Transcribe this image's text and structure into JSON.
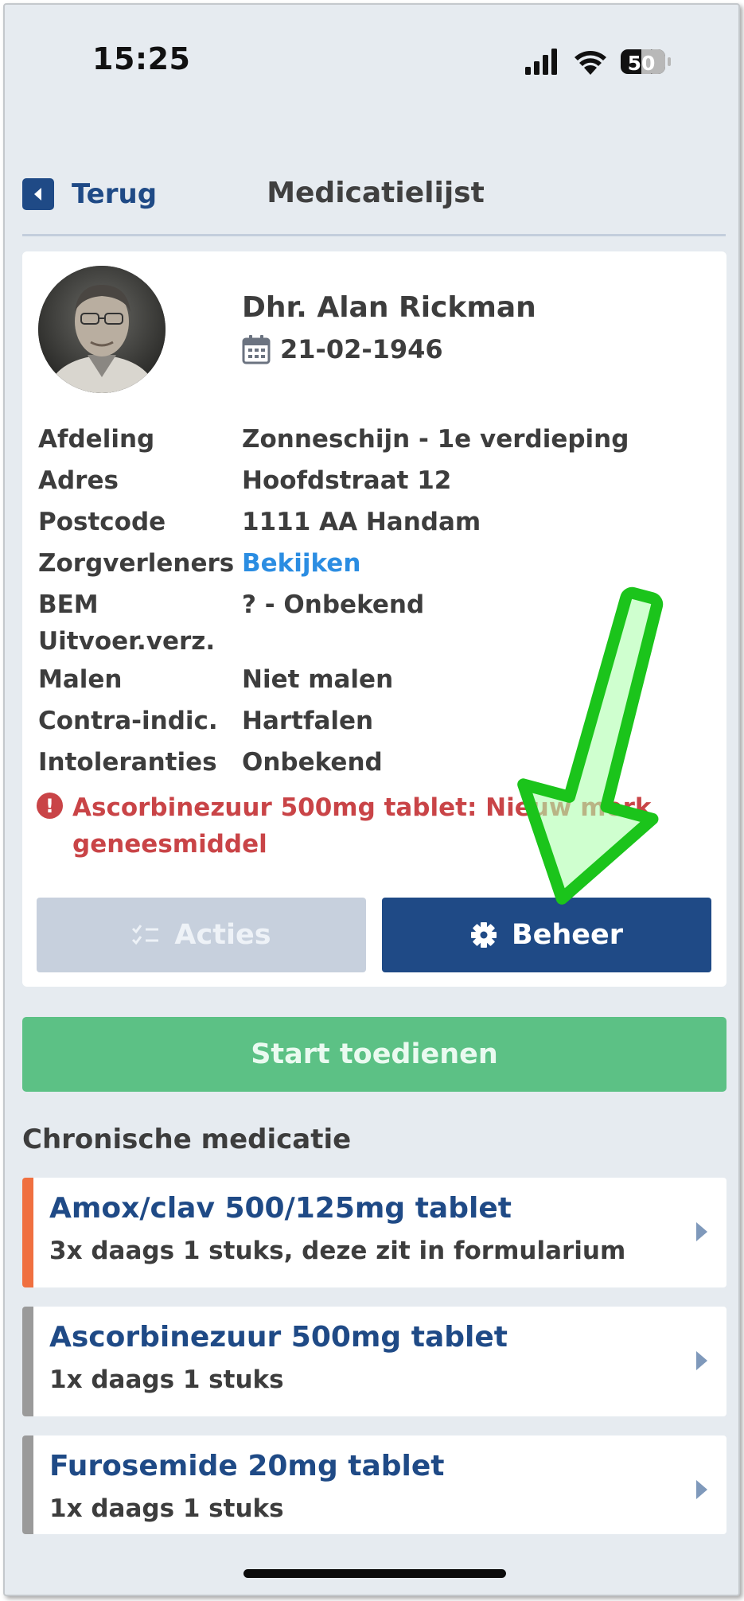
{
  "status_bar": {
    "time": "15:25",
    "battery": "50"
  },
  "header": {
    "back_label": "Terug",
    "title": "Medicatielijst"
  },
  "patient": {
    "name": "Dhr. Alan Rickman",
    "dob": "21-02-1946",
    "fields": [
      {
        "label": "Afdeling",
        "value": "Zonneschijn - 1e verdieping"
      },
      {
        "label": "Adres",
        "value": "Hoofdstraat 12"
      },
      {
        "label": "Postcode",
        "value": "1111 AA Handam"
      },
      {
        "label": "Zorgverleners",
        "value": "Bekijken"
      },
      {
        "label": "BEM",
        "label2": "Uitvoer.verz.",
        "value": "? - Onbekend"
      },
      {
        "label": "Malen",
        "value": "Niet malen"
      },
      {
        "label": "Contra-indic.",
        "value": "Hartfalen"
      },
      {
        "label": "Intoleranties",
        "value": "Onbekend"
      }
    ],
    "warning_line1": "Ascorbinezuur 500mg tablet: Nieuw merk",
    "warning_line2": "geneesmiddel"
  },
  "actions": {
    "acties_label": "Acties",
    "beheer_label": "Beheer"
  },
  "start_label": "Start toedienen",
  "section_title": "Chronische medicatie",
  "medications": [
    {
      "name": "Amox/clav 500/125mg tablet",
      "dose": "3x daags 1 stuks, deze zit in formularium",
      "accent": "#f07040"
    },
    {
      "name": "Ascorbinezuur 500mg tablet",
      "dose": "1x daags 1 stuks",
      "accent": "#9a9a9a"
    },
    {
      "name": "Furosemide 20mg tablet",
      "dose": "1x daags 1 stuks",
      "accent": "#9a9a9a"
    }
  ],
  "icons": {
    "back": "chevron-left-icon",
    "calendar": "calendar-icon",
    "warning": "exclamation-circle-icon",
    "acties": "checklist-icon",
    "beheer": "gear-icon",
    "chevron": "chevron-right-icon"
  },
  "colors": {
    "primary": "#1f4a86",
    "link": "#2b8de2",
    "warning": "#c94447",
    "start": "#5cc185",
    "annotation_arrow": "#1bc41b"
  }
}
